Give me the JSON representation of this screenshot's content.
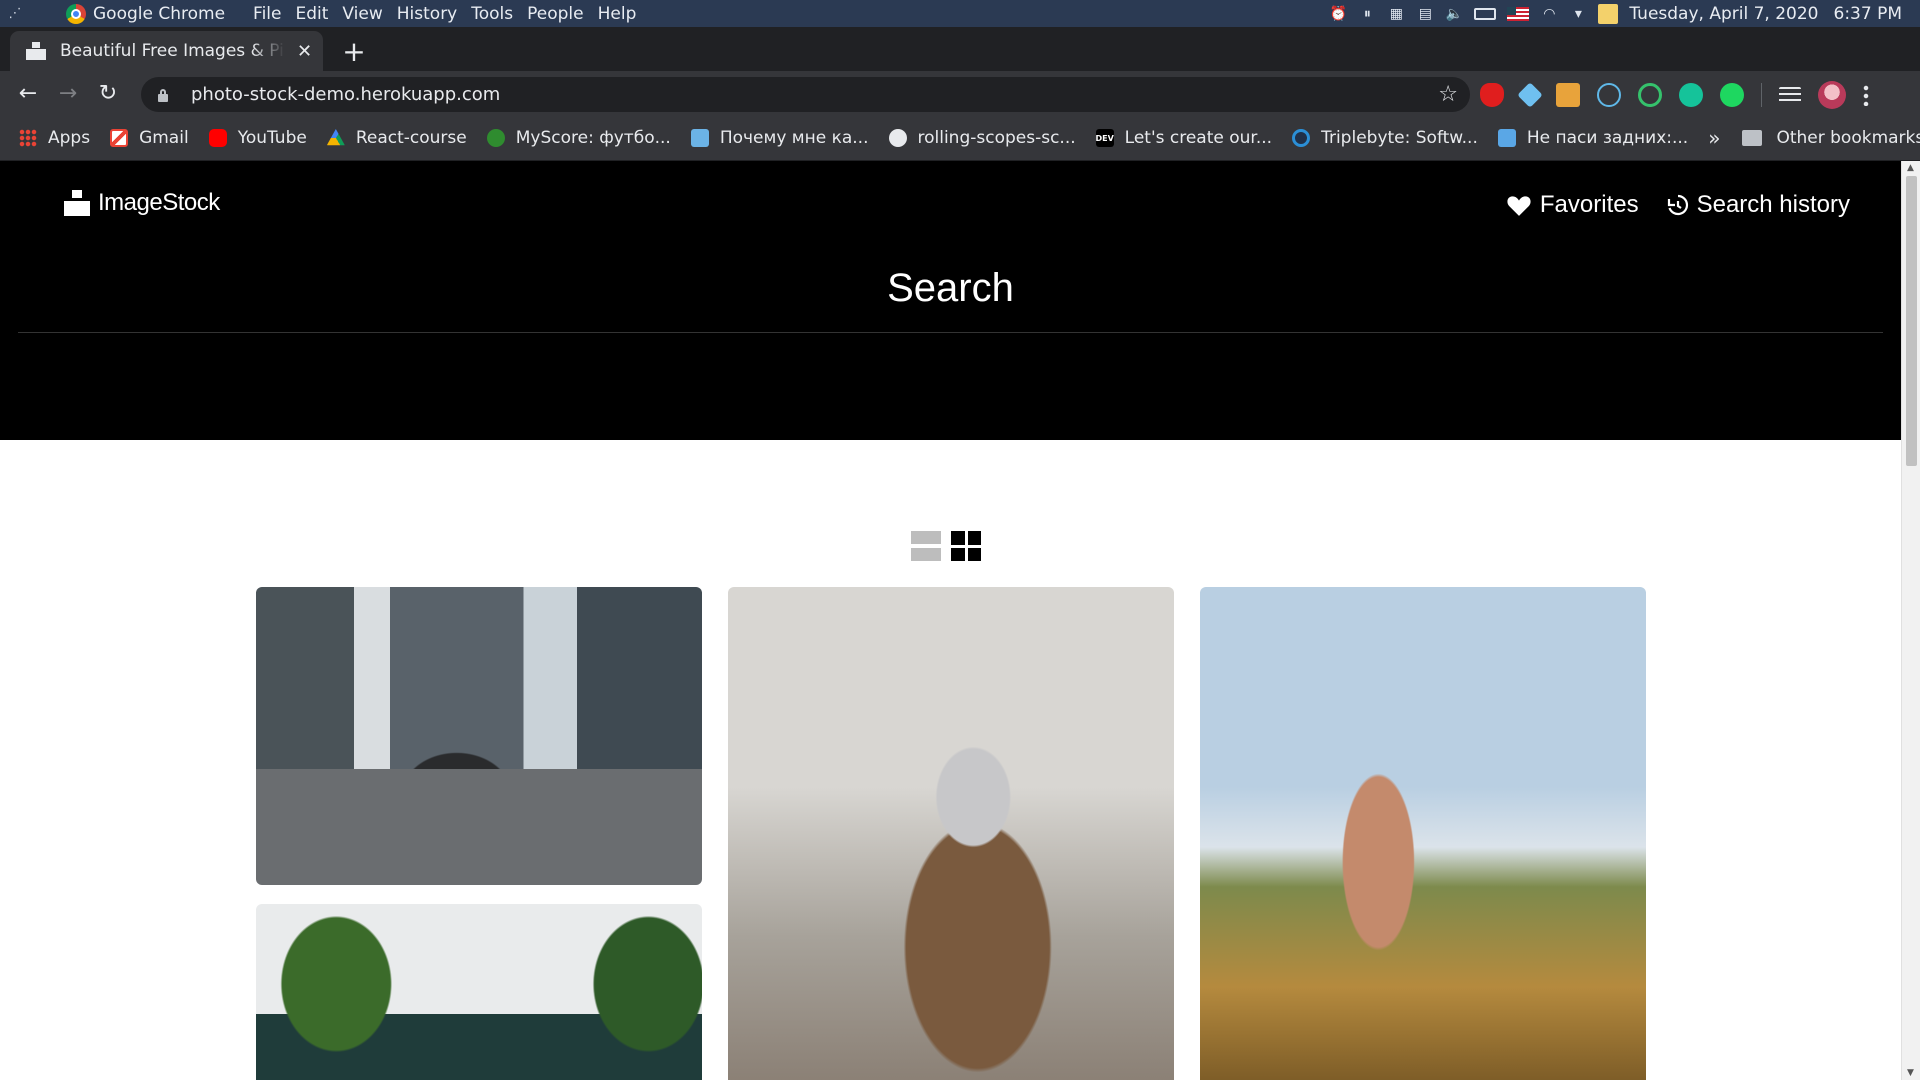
{
  "os": {
    "app_name": "Google Chrome",
    "menu": [
      "File",
      "Edit",
      "View",
      "History",
      "Tools",
      "People",
      "Help"
    ],
    "datetime": "Tuesday, April 7, 2020",
    "time": "6:37 PM"
  },
  "browser": {
    "tab_title": "Beautiful Free Images & Pictures",
    "close_glyph": "✕",
    "new_tab_glyph": "+",
    "url": "photo-stock-demo.herokuapp.com",
    "bookmarks": [
      {
        "label": "Apps",
        "icon": "apps-icon"
      },
      {
        "label": "Gmail",
        "icon": "gmail-icon"
      },
      {
        "label": "YouTube",
        "icon": "youtube-icon"
      },
      {
        "label": "React-course",
        "icon": "drive-icon"
      },
      {
        "label": "MyScore: футбо...",
        "icon": "myscore-icon"
      },
      {
        "label": "Почему мне ка...",
        "icon": "bookmark-icon"
      },
      {
        "label": "rolling-scopes-sc...",
        "icon": "github-icon"
      },
      {
        "label": "Let's create our...",
        "icon": "dev-icon"
      },
      {
        "label": "Triplebyte: Softw...",
        "icon": "triplebyte-icon"
      },
      {
        "label": "Не паси задних:...",
        "icon": "bookmark-icon"
      }
    ],
    "overflow_glyph": "»",
    "other_bookmarks": "Other bookmarks"
  },
  "site": {
    "logo": "ImageStock",
    "nav": {
      "favorites": "Favorites",
      "search_history": "Search history"
    },
    "search_title": "Search",
    "search_placeholder": "",
    "images": [
      {
        "alt": "man riding motorcycle on city road"
      },
      {
        "alt": "person in hoodie reading"
      },
      {
        "alt": "woman sitting in dune grass by the sea"
      },
      {
        "alt": "plants and breathe neon sign"
      }
    ],
    "view_modes": [
      "list",
      "grid"
    ],
    "active_view": "grid"
  }
}
